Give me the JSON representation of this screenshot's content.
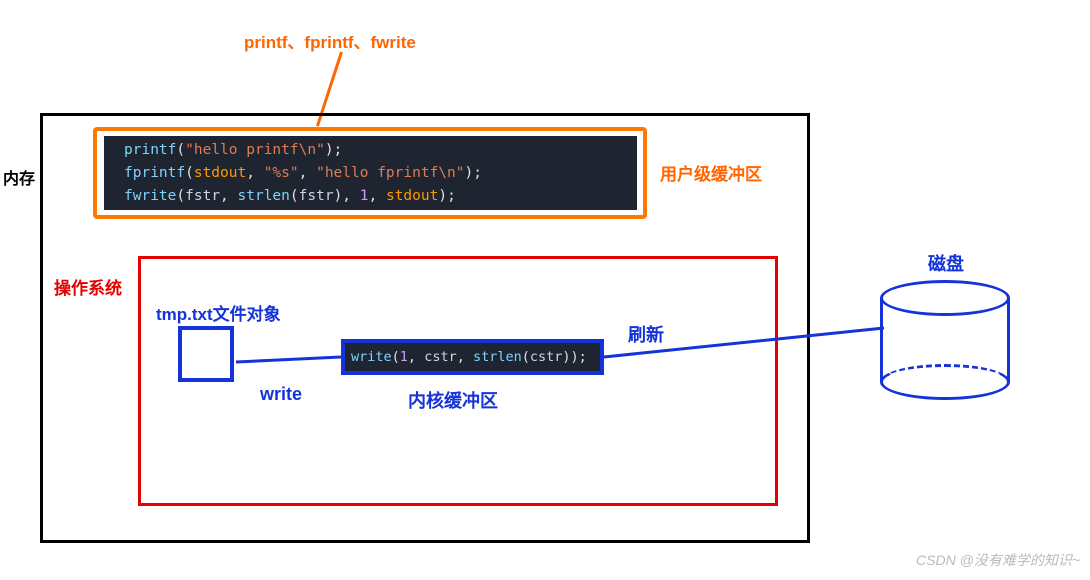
{
  "top_heading": "printf、fprintf、fwrite",
  "labels": {
    "memory": "内存",
    "user_buffer": "用户级缓冲区",
    "os": "操作系统",
    "tmp_file": "tmp.txt文件对象",
    "write": "write",
    "kernel_buffer": "内核缓冲区",
    "refresh": "刷新",
    "disk": "磁盘"
  },
  "code1": {
    "l1_fn": "printf",
    "l1_a1": "\"hello printf\\n\"",
    "l2_fn": "fprintf",
    "l2_a1": "stdout",
    "l2_a2": "\"%s\"",
    "l2_a3": "\"hello fprintf\\n\"",
    "l3_fn": "fwrite",
    "l3_a1": "fstr",
    "l3_a2_fn": "strlen",
    "l3_a2_arg": "fstr",
    "l3_a3": "1",
    "l3_a4": "stdout"
  },
  "code2": {
    "fn": "write",
    "a1": "1",
    "a2": "cstr",
    "a3_fn": "strlen",
    "a3_arg": "cstr"
  },
  "watermark": "CSDN @没有难学的知识~"
}
